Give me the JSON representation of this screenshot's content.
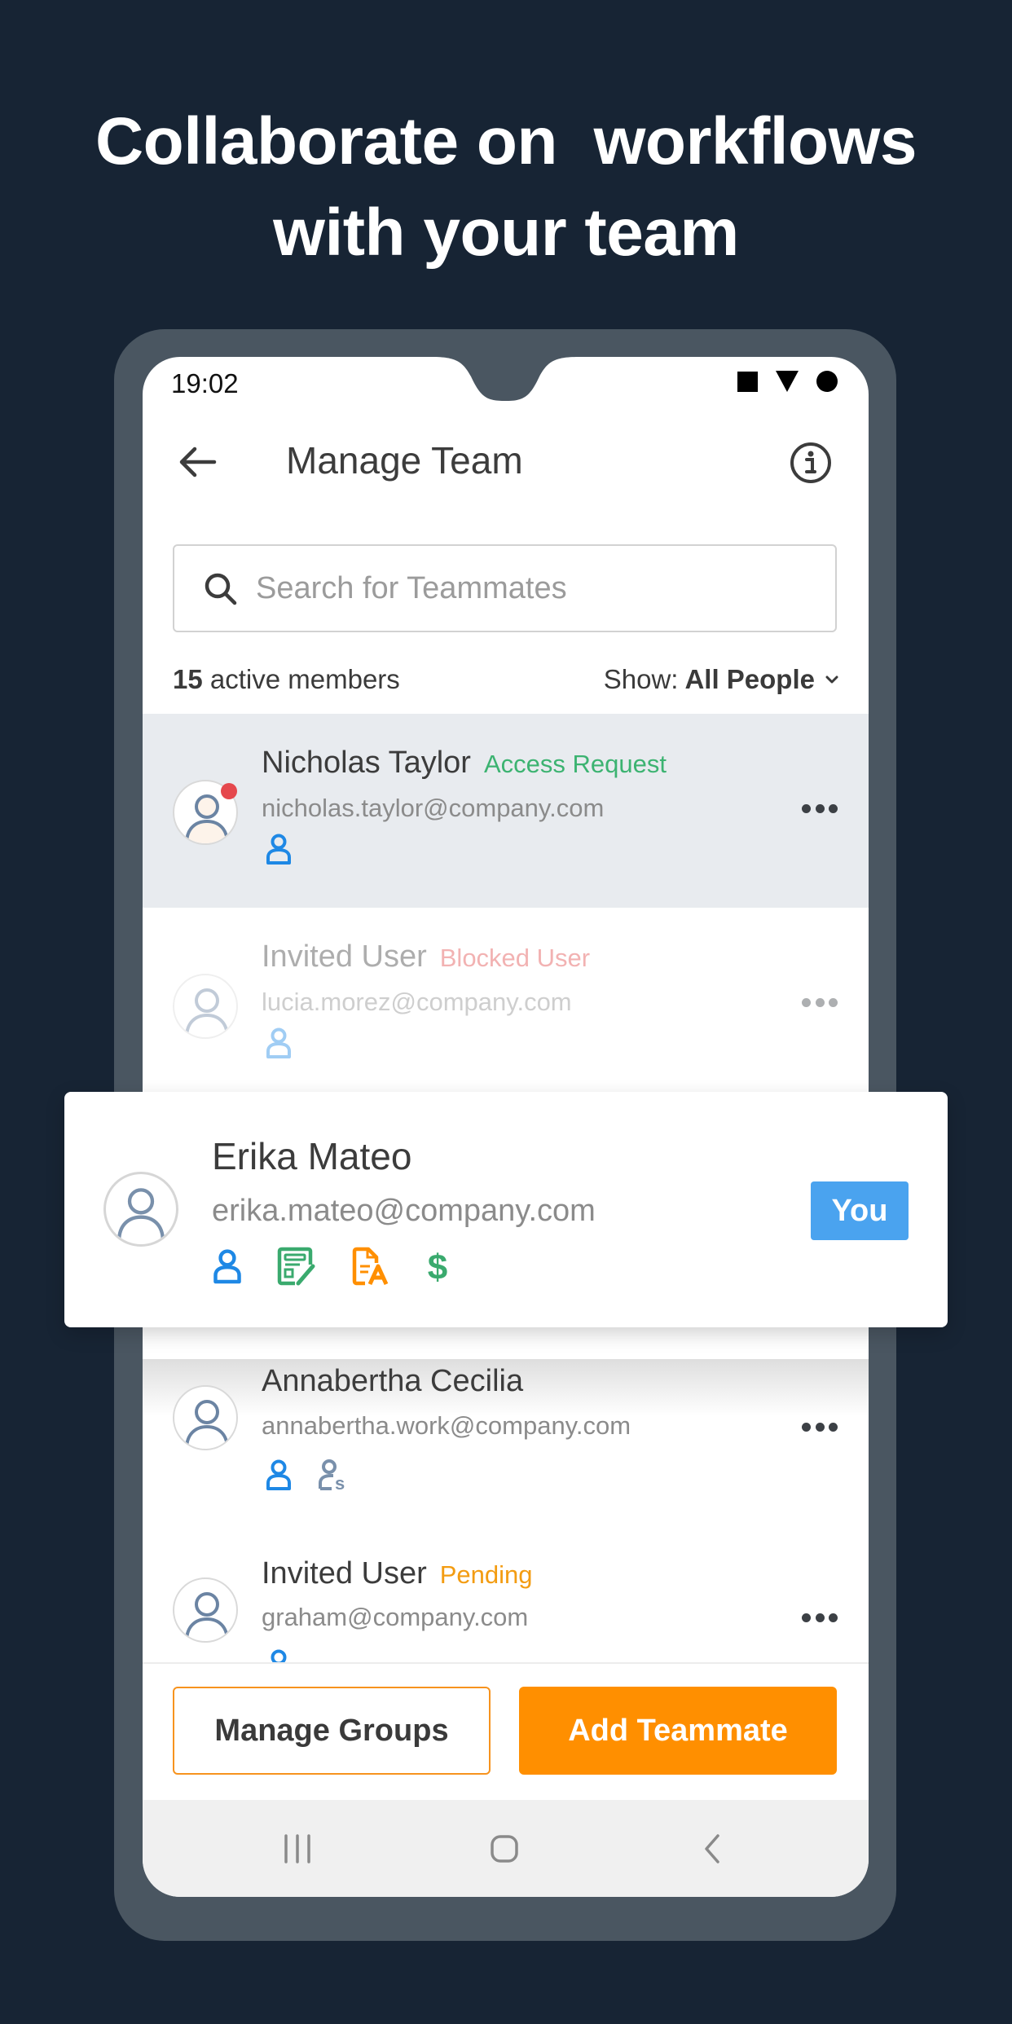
{
  "headline": {
    "line1": "Collaborate on  workflows",
    "line2": "with your team"
  },
  "status_bar": {
    "time": "19:02",
    "icons": [
      "square-icon",
      "triangle-icon",
      "circle-icon"
    ]
  },
  "header": {
    "title": "Manage Team",
    "back_icon": "arrow-left-icon",
    "info_icon": "info-icon"
  },
  "search": {
    "placeholder": "Search for Teammates",
    "value": ""
  },
  "summary": {
    "count": "15",
    "count_label": " active members",
    "show_label": "Show:",
    "show_value": "All People"
  },
  "members": [
    {
      "name": "Nicholas Taylor",
      "tag": "Access Request",
      "tag_color": "#3cb371",
      "email": "nicholas.taylor@company.com",
      "roles": [
        "user-role-icon"
      ],
      "highlighted": true,
      "notification": true
    },
    {
      "name": "Invited User",
      "tag": "Blocked User",
      "tag_color": "#e57373",
      "email": "lucia.morez@company.com",
      "roles": [
        "user-role-icon"
      ],
      "faded": true
    },
    {
      "name": "Annabertha Cecilia",
      "tag": "",
      "email": "annabertha.work@company.com",
      "roles": [
        "user-role-icon",
        "supervisor-role-icon"
      ]
    },
    {
      "name": "Invited User",
      "tag": "Pending",
      "tag_color": "#f39c12",
      "email": "graham@company.com",
      "roles": [
        "user-role-icon"
      ]
    }
  ],
  "current_user_card": {
    "name": "Erika Mateo",
    "email": "erika.mateo@company.com",
    "badge": "You",
    "roles": [
      "user-role-icon",
      "form-editor-icon",
      "document-signer-icon",
      "billing-icon"
    ]
  },
  "actions": {
    "manage_groups": "Manage Groups",
    "add_teammate": "Add Teammate"
  },
  "colors": {
    "background": "#172434",
    "accent_orange": "#ff8f00",
    "badge_blue": "#4aa3ef",
    "role_blue": "#1e88e5",
    "role_green": "#3aaa6e"
  }
}
